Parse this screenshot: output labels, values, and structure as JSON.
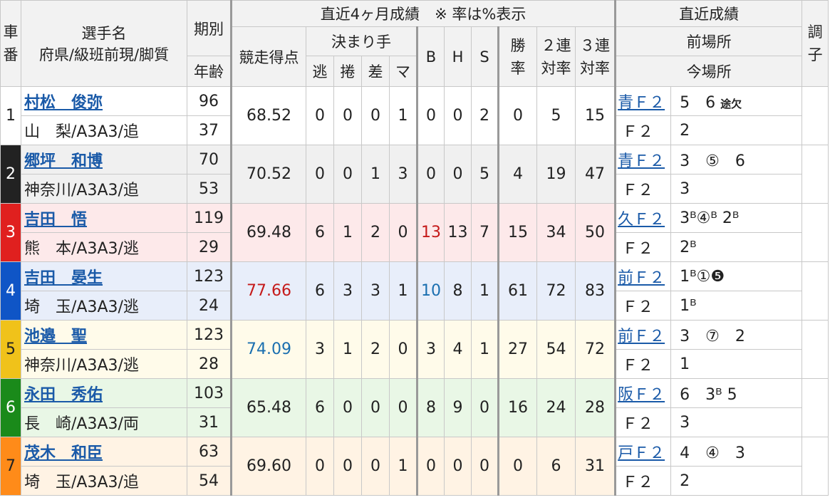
{
  "headers": {
    "car": "車\n番",
    "name_line1": "選手名",
    "name_line2": "府県/級班前現/脚質",
    "term": "期別",
    "age": "年齢",
    "recent4": "直近4ヶ月成績　※ 率は%表示",
    "score": "競走得点",
    "kimarite": "決まり手",
    "k_nige": "逃",
    "k_makuri": "捲",
    "k_sashi": "差",
    "k_ma": "マ",
    "b": "B",
    "h": "H",
    "s": "S",
    "win": "勝\n率",
    "ren2": "２連\n対率",
    "ren3": "３連\n対率",
    "recent_results": "直近成績",
    "prev_venue": "前場所",
    "cur_venue": "今場所",
    "condition": "調\n子"
  },
  "riders": [
    {
      "car": "1",
      "name": "村松　俊弥",
      "info": "山　梨/A3A3/追",
      "term": "96",
      "age": "37",
      "score": "68.52",
      "score_color": "",
      "nige": "0",
      "makuri": "0",
      "sashi": "0",
      "ma": "1",
      "b": "0",
      "b_color": "",
      "h": "0",
      "s": "2",
      "win": "0",
      "ren2": "5",
      "ren3": "15",
      "venue_link": "青Ｆ２",
      "prev": "5　6",
      "prev_extra": "途欠",
      "cur_venue": "Ｆ２",
      "cur": "2"
    },
    {
      "car": "2",
      "name": "郷坪　和博",
      "info": "神奈川/A3A3/追",
      "term": "70",
      "age": "53",
      "score": "70.52",
      "score_color": "",
      "nige": "0",
      "makuri": "0",
      "sashi": "1",
      "ma": "3",
      "b": "0",
      "b_color": "",
      "h": "0",
      "s": "5",
      "win": "4",
      "ren2": "19",
      "ren3": "47",
      "venue_link": "青Ｆ２",
      "prev": "3　⑤　6",
      "prev_extra": "",
      "cur_venue": "Ｆ２",
      "cur": "3"
    },
    {
      "car": "3",
      "name": "吉田　悟",
      "info": "熊　本/A3A3/逃",
      "term": "119",
      "age": "29",
      "score": "69.48",
      "score_color": "",
      "nige": "6",
      "makuri": "1",
      "sashi": "2",
      "ma": "0",
      "b": "13",
      "b_color": "red",
      "h": "13",
      "s": "7",
      "win": "15",
      "ren2": "34",
      "ren3": "50",
      "venue_link": "久Ｆ２",
      "prev": "3ᴮ④ᴮ 2ᴮ",
      "prev_extra": "",
      "cur_venue": "Ｆ２",
      "cur": "2ᴮ"
    },
    {
      "car": "4",
      "name": "吉田　晏生",
      "info": "埼　玉/A3A3/逃",
      "term": "123",
      "age": "24",
      "score": "77.66",
      "score_color": "red",
      "nige": "6",
      "makuri": "3",
      "sashi": "3",
      "ma": "1",
      "b": "10",
      "b_color": "blue",
      "h": "8",
      "s": "1",
      "win": "61",
      "ren2": "72",
      "ren3": "83",
      "venue_link": "前Ｆ２",
      "prev": "1ᴮ①❺",
      "prev_extra": "",
      "cur_venue": "Ｆ２",
      "cur": "1ᴮ"
    },
    {
      "car": "5",
      "name": "池邉　聖",
      "info": "神奈川/A3A3/逃",
      "term": "123",
      "age": "28",
      "score": "74.09",
      "score_color": "blue",
      "nige": "3",
      "makuri": "1",
      "sashi": "2",
      "ma": "0",
      "b": "3",
      "b_color": "",
      "h": "4",
      "s": "1",
      "win": "27",
      "ren2": "54",
      "ren3": "72",
      "venue_link": "前Ｆ２",
      "prev": "3　⑦　2",
      "prev_extra": "",
      "cur_venue": "Ｆ２",
      "cur": "1"
    },
    {
      "car": "6",
      "name": "永田　秀佑",
      "info": "長　崎/A3A3/両",
      "term": "103",
      "age": "31",
      "score": "65.48",
      "score_color": "",
      "nige": "6",
      "makuri": "0",
      "sashi": "0",
      "ma": "0",
      "b": "8",
      "b_color": "",
      "h": "9",
      "s": "0",
      "win": "16",
      "ren2": "24",
      "ren3": "28",
      "venue_link": "阪Ｆ２",
      "prev": "6　3ᴮ 5",
      "prev_extra": "",
      "cur_venue": "Ｆ２",
      "cur": "3"
    },
    {
      "car": "7",
      "name": "茂木　和臣",
      "info": "埼　玉/A3A3/追",
      "term": "63",
      "age": "54",
      "score": "69.60",
      "score_color": "",
      "nige": "0",
      "makuri": "0",
      "sashi": "0",
      "ma": "1",
      "b": "0",
      "b_color": "",
      "h": "0",
      "s": "0",
      "win": "0",
      "ren2": "6",
      "ren3": "31",
      "venue_link": "戸Ｆ２",
      "prev": "4　④　3",
      "prev_extra": "",
      "cur_venue": "Ｆ２",
      "cur": "2"
    }
  ]
}
